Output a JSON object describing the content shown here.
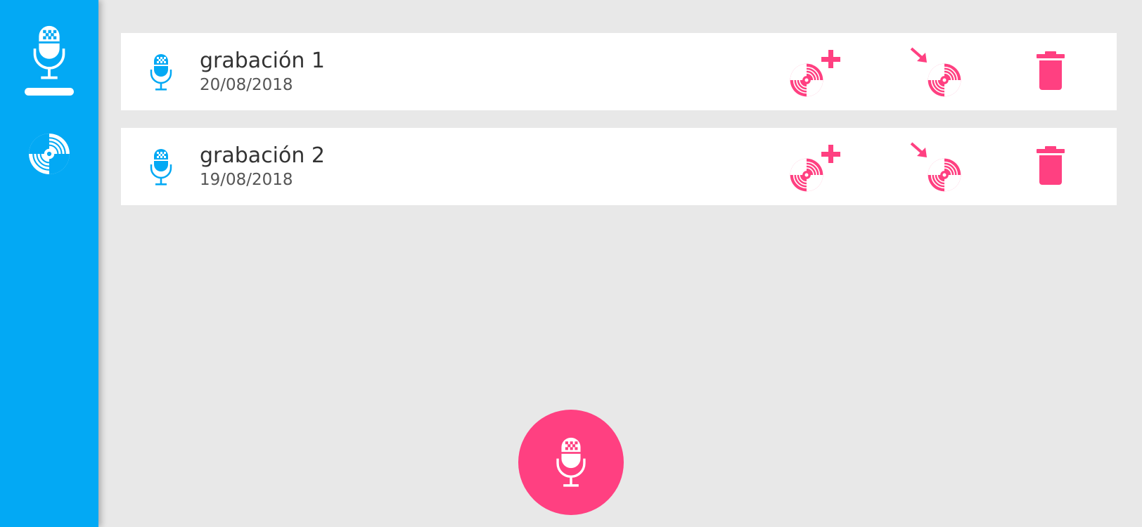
{
  "theme": {
    "primary": "#03a9f4",
    "accent": "#ff4081",
    "background": "#e8e8e8"
  },
  "sidebar": {
    "items": [
      {
        "icon": "microphone-icon",
        "active": true
      },
      {
        "icon": "disc-icon",
        "active": false
      }
    ]
  },
  "recordings": [
    {
      "title": "grabación 1",
      "date": "20/08/2018",
      "actions": [
        "disc-add-icon",
        "disc-import-icon",
        "trash-icon"
      ]
    },
    {
      "title": "grabación 2",
      "date": "19/08/2018",
      "actions": [
        "disc-add-icon",
        "disc-import-icon",
        "trash-icon"
      ]
    }
  ],
  "fab": {
    "icon": "microphone-icon"
  }
}
